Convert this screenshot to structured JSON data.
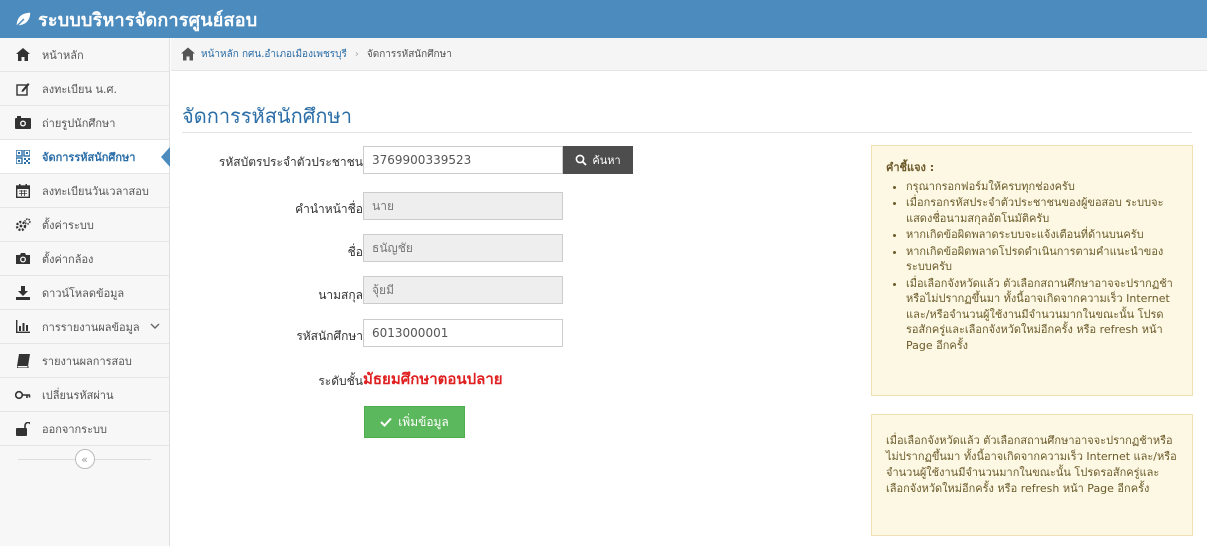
{
  "app": {
    "title": "ระบบบริหารจัดการศูนย์สอบ"
  },
  "sidebar": {
    "items": [
      {
        "label": "หน้าหลัก",
        "icon": "home-icon"
      },
      {
        "label": "ลงทะเบียน น.ศ.",
        "icon": "edit-icon"
      },
      {
        "label": "ถ่ายรูปนักศึกษา",
        "icon": "photo-icon"
      },
      {
        "label": "จัดการรหัสนักศึกษา",
        "icon": "qrcode-icon"
      },
      {
        "label": "ลงทะเบียนวันเวลาสอบ",
        "icon": "calendar-icon"
      },
      {
        "label": "ตั้งค่าระบบ",
        "icon": "gears-icon"
      },
      {
        "label": "ตั้งค่ากล้อง",
        "icon": "camera-icon"
      },
      {
        "label": "ดาวน์โหลดข้อมูล",
        "icon": "download-icon"
      },
      {
        "label": "การรายงานผลข้อมูล",
        "icon": "bar-chart-icon"
      },
      {
        "label": "รายงานผลการสอบ",
        "icon": "book-icon"
      },
      {
        "label": "เปลี่ยนรหัสผ่าน",
        "icon": "key-icon"
      },
      {
        "label": "ออกจากระบบ",
        "icon": "unlock-icon"
      }
    ],
    "active_index": 3,
    "collapse_glyph": "«"
  },
  "breadcrumb": {
    "home": "หน้าหลัก กศน.อำเภอเมืองเพชรบุรี",
    "separator": "›",
    "current": "จัดการรหัสนักศึกษา"
  },
  "page": {
    "title": "จัดการรหัสนักศึกษา"
  },
  "form": {
    "id_card_label": "รหัสบัตรประจำตัวประชาชน",
    "id_card_value": "3769900339523",
    "search_label": "ค้นหา",
    "prefix_label": "คำนำหน้าชื่อ",
    "prefix_value": "นาย",
    "firstname_label": "ชื่อ",
    "firstname_value": "ธนัญชัย",
    "lastname_label": "นามสกุล",
    "lastname_value": "จุ้ยมี",
    "student_id_label": "รหัสนักศึกษา",
    "student_id_value": "6013000001",
    "level_label": "ระดับชั้น",
    "level_value": "มัธยมศึกษาตอนปลาย",
    "add_label": "เพิ่มข้อมูล"
  },
  "notes": {
    "title": "คำชี้แจง :",
    "items": [
      "กรุณากรอกฟอร์มให้ครบทุกช่องครับ",
      "เมื่อกรอกรหัสประจำตัวประชาชนของผู้ขอสอบ ระบบจะแสดงชื่อนามสกุลอัตโนมัติครับ",
      "หากเกิดข้อผิดพลาดระบบจะแจ้งเตือนที่ด้านบนครับ",
      "หากเกิดข้อผิดพลาดโปรดดำเนินการตามคำแนะนำของระบบครับ",
      "เมื่อเลือกจังหวัดแล้ว ตัวเลือกสถานศึกษาอาจจะปรากฏช้าหรือไม่ปรากฏขึ้นมา ทั้งนี้อาจเกิดจากความเร็ว Internet และ/หรือจำนวนผู้ใช้งานมีจำนวนมากในขณะนั้น โปรดรอสักครู่และเลือกจังหวัดใหม่อีกครั้ง หรือ refresh หน้า Page อีกครั้ง"
    ],
    "second": "เมื่อเลือกจังหวัดแล้ว ตัวเลือกสถานศึกษาอาจจะปรากฏช้าหรือไม่ปรากฏขึ้นมา ทั้งนี้อาจเกิดจากความเร็ว Internet และ/หรือจำนวนผู้ใช้งานมีจำนวนมากในขณะนั้น โปรดรอสักครู่และเลือกจังหวัดใหม่อีกครั้ง หรือ refresh หน้า Page อีกครั้ง"
  },
  "colors": {
    "header": "#4b8bbe",
    "accent": "#2b6ea7",
    "success": "#5cb85c",
    "danger": "#e02020",
    "note_bg": "#fcf8e3"
  }
}
